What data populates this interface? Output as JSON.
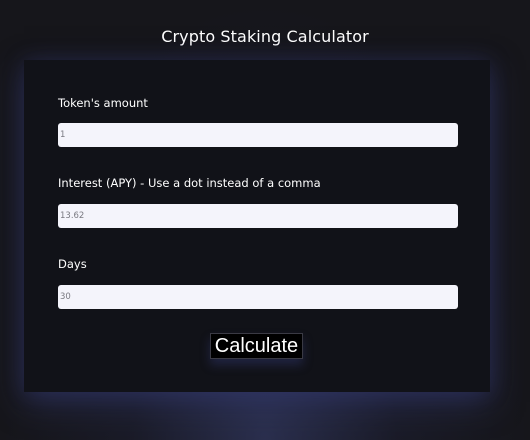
{
  "page": {
    "title": "Crypto Staking Calculator"
  },
  "form": {
    "fields": [
      {
        "label": "Token's amount",
        "value": "1"
      },
      {
        "label": "Interest (APY) - Use a dot instead of a comma",
        "value": "13.62"
      },
      {
        "label": "Days",
        "value": "30"
      }
    ],
    "calculate_label": "Calculate"
  },
  "colors": {
    "background": "#17171c",
    "card": "#111218",
    "input_background": "#f4f4fb",
    "button_background": "#000000",
    "glow": "#3c4478"
  }
}
